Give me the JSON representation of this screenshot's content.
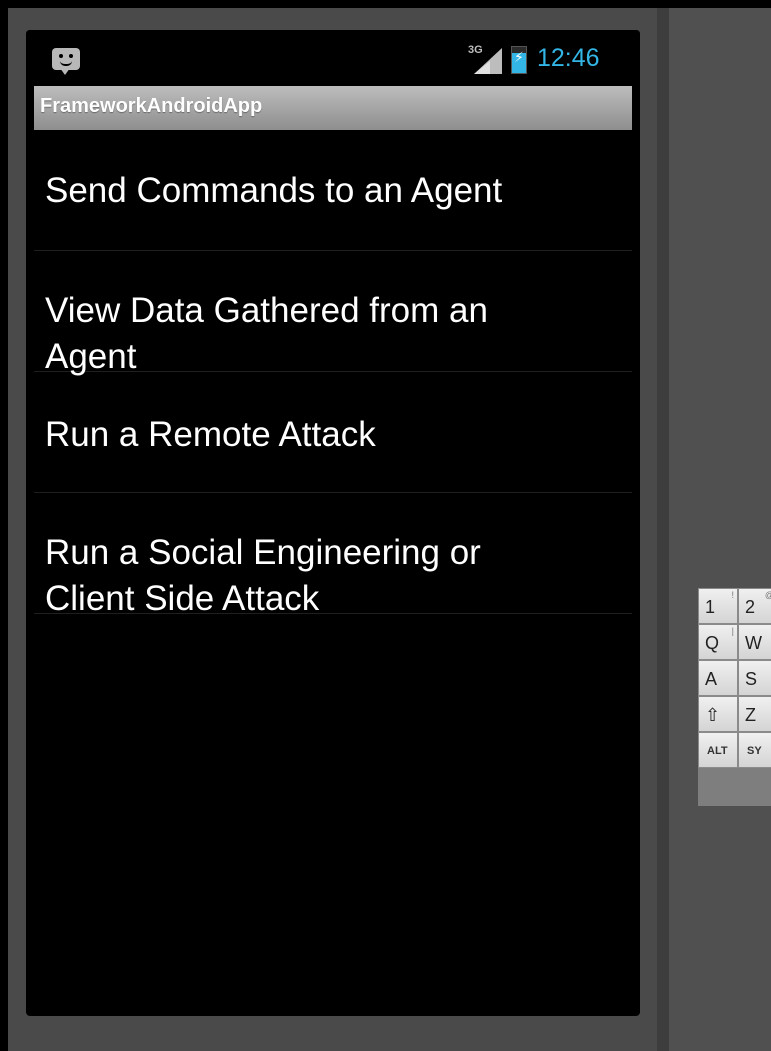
{
  "status_bar": {
    "network": "3G",
    "time": "12:46",
    "icons": [
      "notification-chat-icon",
      "signal-icon",
      "battery-charging-icon"
    ]
  },
  "app": {
    "title": "FrameworkAndroidApp"
  },
  "menu": {
    "items": [
      {
        "label": "Send Commands to an Agent"
      },
      {
        "label_line1": "View Data Gathered from an",
        "label_line2": "Agent"
      },
      {
        "label": "Run a Remote Attack"
      },
      {
        "label_line1": "Run a Social Engineering or",
        "label_line2": "Client Side Attack"
      }
    ]
  },
  "keyboard": {
    "rows": [
      {
        "keys": [
          "1",
          "2"
        ],
        "alt": [
          "!",
          "@"
        ]
      },
      {
        "keys": [
          "Q",
          "W"
        ],
        "alt": [
          "|",
          ""
        ]
      },
      {
        "keys": [
          "A",
          "S"
        ]
      },
      {
        "keys": [
          "⇧",
          "Z"
        ]
      },
      {
        "keys": [
          "ALT",
          "SY"
        ]
      }
    ]
  },
  "colors": {
    "accent": "#33b5e5",
    "title_bar_top": "#bdbdbd",
    "title_bar_bottom": "#8e8e8e",
    "screen_background": "#000000"
  }
}
